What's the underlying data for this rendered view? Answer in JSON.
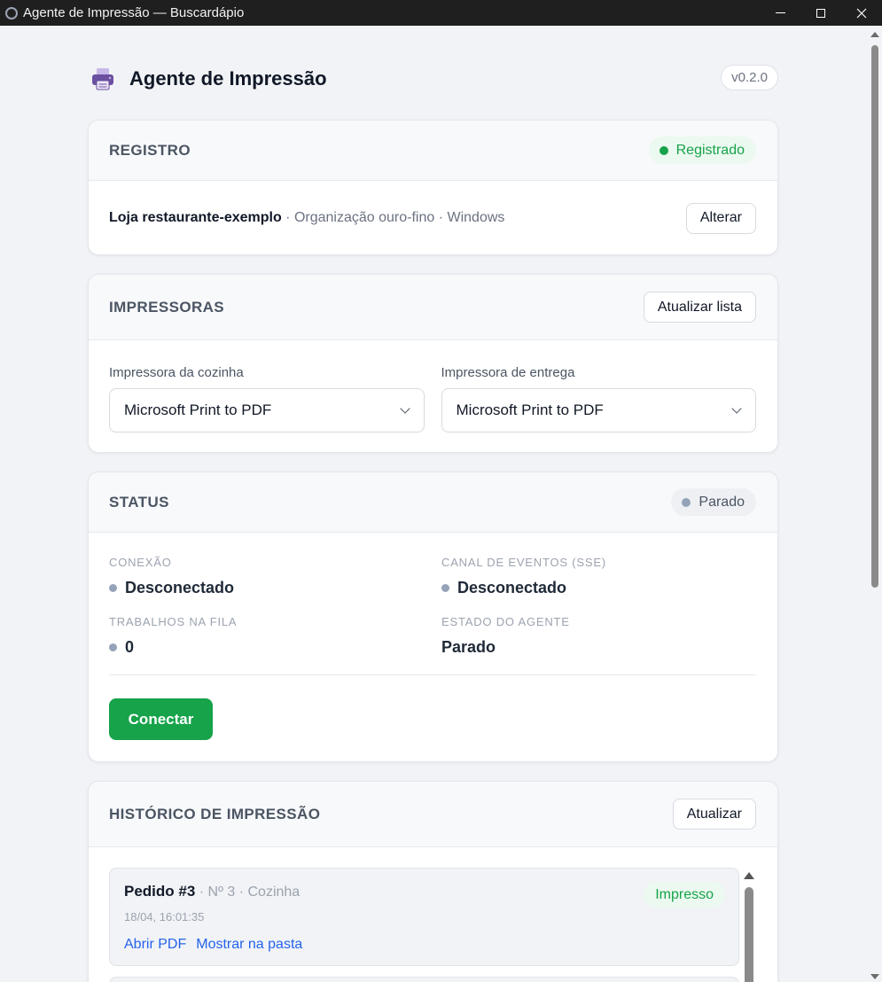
{
  "window": {
    "title": "Agente de Impressão — Buscardápio"
  },
  "header": {
    "title": "Agente de Impressão",
    "version": "v0.2.0",
    "icon": "printer-icon"
  },
  "registro": {
    "title": "REGISTRO",
    "badge": "Registrado",
    "store": "Loja restaurante-exemplo",
    "meta": " · Organização ouro-fino · Windows",
    "change_button": "Alterar"
  },
  "impressoras": {
    "title": "IMPRESSORAS",
    "refresh_button": "Atualizar lista",
    "kitchen": {
      "label": "Impressora da cozinha",
      "value": "Microsoft Print to PDF"
    },
    "delivery": {
      "label": "Impressora de entrega",
      "value": "Microsoft Print to PDF"
    }
  },
  "status": {
    "title": "STATUS",
    "badge": "Parado",
    "connection": {
      "label": "CONEXÃO",
      "value": "Desconectado"
    },
    "events": {
      "label": "CANAL DE EVENTOS (SSE)",
      "value": "Desconectado"
    },
    "queue": {
      "label": "TRABALHOS NA FILA",
      "value": "0"
    },
    "agent": {
      "label": "ESTADO DO AGENTE",
      "value": "Parado"
    },
    "connect_button": "Conectar"
  },
  "historico": {
    "title": "HISTÓRICO DE IMPRESSÃO",
    "refresh_button": "Atualizar",
    "jobs": [
      {
        "title": "Pedido #3",
        "meta": " · Nº 3 · Cozinha",
        "time": "18/04, 16:01:35",
        "status": "Impresso",
        "open_pdf": "Abrir PDF",
        "show_folder": "Mostrar na pasta"
      }
    ]
  },
  "colors": {
    "accent_green": "#16a34a",
    "link_blue": "#2563eb",
    "muted_dot": "#94a3b8"
  }
}
